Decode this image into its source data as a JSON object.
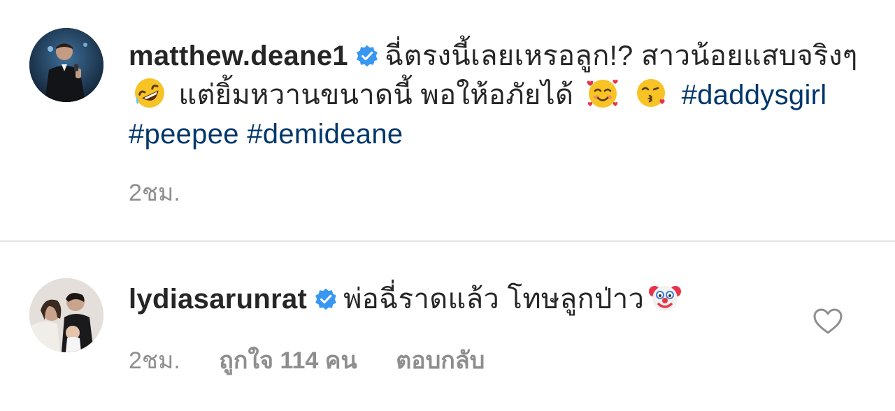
{
  "caption": {
    "username": "matthew.deane1",
    "text_part1": "ฉี่ตรงนี้เลยเหรอลูก!? สาวน้อยแสบจริงๆ",
    "text_part2": "แต่ยิ้มหวานขนาดนี้ พอให้อภัยได้",
    "hashtags": "#daddysgirl #peepee #demideane",
    "time": "2ชม.",
    "emojis": [
      "rofl-emoji",
      "smiling-face-with-hearts-emoji",
      "face-blowing-kiss-emoji"
    ]
  },
  "reply": {
    "username": "lydiasarunrat",
    "text": "พ่อฉี่ราดแล้ว โทษลูกป่าว",
    "time": "2ชม.",
    "likes": "ถูกใจ 114 คน",
    "reply_label": "ตอบกลับ",
    "emojis": [
      "clown-face-emoji"
    ]
  },
  "colors": {
    "verified_blue": "#3897f0",
    "hashtag_blue": "#00376b",
    "meta_gray": "#8e8e8e",
    "divider": "#e4e4e4"
  }
}
